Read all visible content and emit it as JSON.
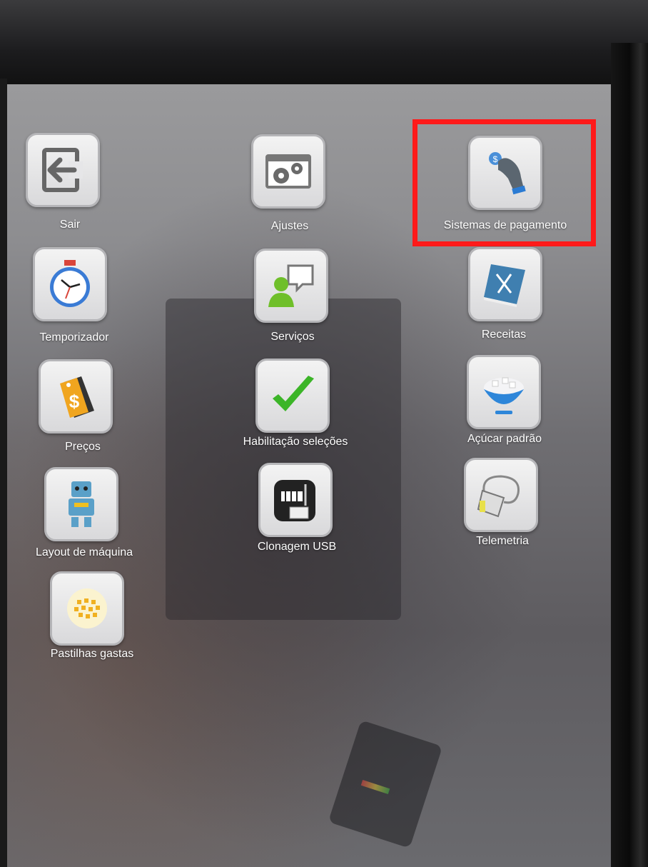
{
  "menu": {
    "items": [
      {
        "id": "sair",
        "label": "Sair",
        "icon": "exit-icon"
      },
      {
        "id": "ajustes",
        "label": "Ajustes",
        "icon": "settings-gears-icon"
      },
      {
        "id": "pagamento",
        "label": "Sistemas de pagamento",
        "icon": "hand-coin-icon"
      },
      {
        "id": "temporizador",
        "label": "Temporizador",
        "icon": "stopwatch-icon"
      },
      {
        "id": "servicos",
        "label": "Serviços",
        "icon": "person-chat-icon"
      },
      {
        "id": "receitas",
        "label": "Receitas",
        "icon": "recipe-book-icon"
      },
      {
        "id": "precos",
        "label": "Preços",
        "icon": "price-tag-icon"
      },
      {
        "id": "habilitacao",
        "label": "Habilitação seleções",
        "icon": "checkmark-icon"
      },
      {
        "id": "acucar",
        "label": "Açúcar padrão",
        "icon": "sugar-bowl-icon"
      },
      {
        "id": "layout",
        "label": "Layout de máquina",
        "icon": "robot-icon"
      },
      {
        "id": "clonagem",
        "label": "Clonagem USB",
        "icon": "usb-machine-icon"
      },
      {
        "id": "telemetria",
        "label": "Telemetria",
        "icon": "telemetry-cable-icon"
      },
      {
        "id": "pastilhas",
        "label": "Pastilhas gastas",
        "icon": "tablets-icon"
      }
    ]
  },
  "highlighted_item": "pagamento",
  "colors": {
    "highlight": "#ff1a1a",
    "check": "#3cb528",
    "servicos_person": "#6fbf2a"
  }
}
